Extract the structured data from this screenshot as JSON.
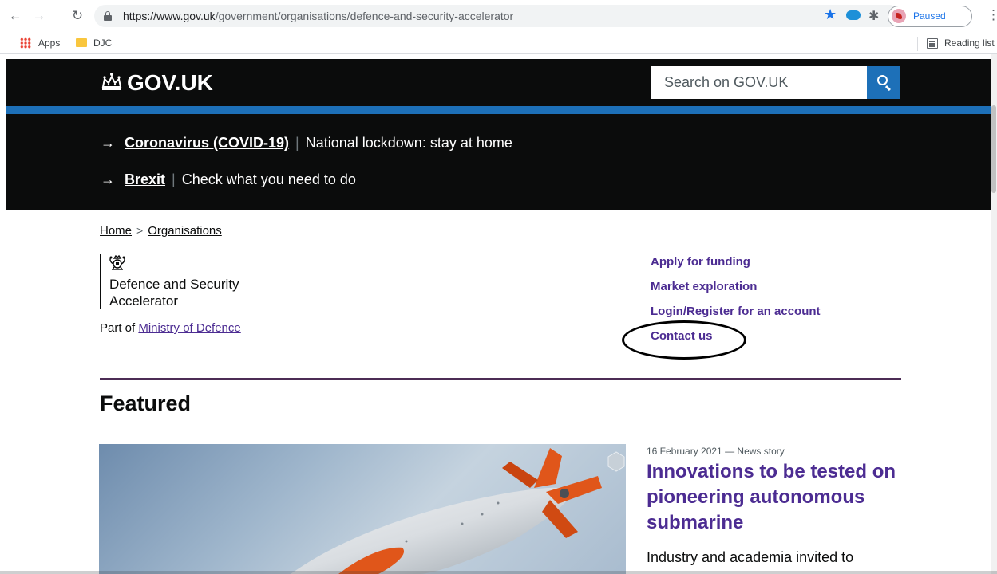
{
  "browser": {
    "url_host": "https://www.gov.uk",
    "url_path": "/government/organisations/defence-and-security-accelerator",
    "profile_label": "Paused",
    "bookmarks": [
      {
        "label": "Apps"
      },
      {
        "label": "DJC"
      }
    ],
    "reading_list_label": "Reading list"
  },
  "header": {
    "logo_text": "GOV.UK",
    "search_placeholder": "Search on GOV.UK"
  },
  "notices": [
    {
      "link": "Coronavirus (COVID-19)",
      "text": "National lockdown: stay at home"
    },
    {
      "link": "Brexit",
      "text": "Check what you need to do"
    }
  ],
  "breadcrumb": [
    {
      "label": "Home"
    },
    {
      "label": "Organisations"
    }
  ],
  "organisation": {
    "name_line1": "Defence and Security",
    "name_line2": "Accelerator",
    "part_of_prefix": "Part of",
    "parent": "Ministry of Defence"
  },
  "quick_links": [
    {
      "label": "Apply for funding"
    },
    {
      "label": "Market exploration"
    },
    {
      "label": "Login/Register for an account"
    },
    {
      "label": "Contact us"
    }
  ],
  "featured": {
    "heading": "Featured",
    "story": {
      "meta": "16 February 2021 — News story",
      "title": "Innovations to be tested on pioneering autonomous submarine",
      "summary": "Industry and academia invited to"
    }
  },
  "colors": {
    "gov_black": "#0b0c0c",
    "gov_blue": "#1d70b8",
    "link_purple": "#4c2c92",
    "fin_orange": "#e0561a"
  }
}
